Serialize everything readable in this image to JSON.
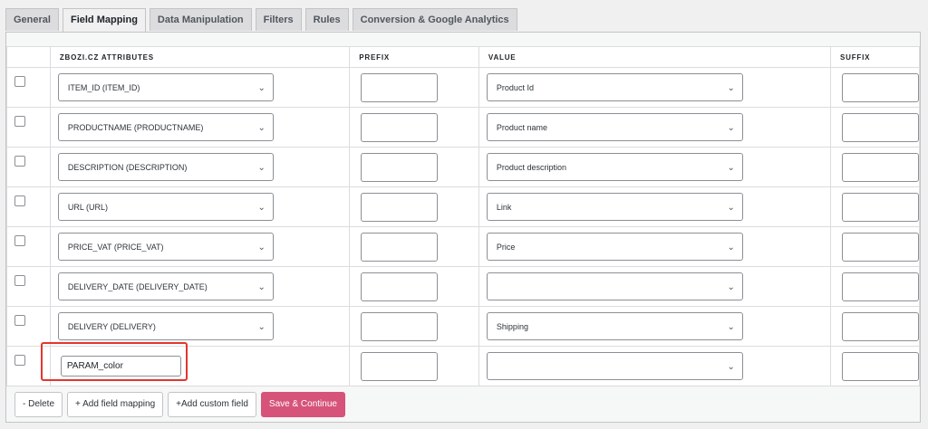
{
  "tabs": [
    {
      "label": "General"
    },
    {
      "label": "Field Mapping",
      "active": true
    },
    {
      "label": "Data Manipulation"
    },
    {
      "label": "Filters"
    },
    {
      "label": "Rules"
    },
    {
      "label": "Conversion & Google Analytics"
    }
  ],
  "table": {
    "headers": [
      "ZBOZI.CZ ATTRIBUTES",
      "PREFIX",
      "VALUE",
      "SUFFIX"
    ],
    "rows": [
      {
        "attribute": "ITEM_ID (ITEM_ID)",
        "value": "Product Id"
      },
      {
        "attribute": "PRODUCTNAME (PRODUCTNAME)",
        "value": "Product name"
      },
      {
        "attribute": "DESCRIPTION (DESCRIPTION)",
        "value": "Product description"
      },
      {
        "attribute": "URL (URL)",
        "value": "Link"
      },
      {
        "attribute": "PRICE_VAT (PRICE_VAT)",
        "value": "Price"
      },
      {
        "attribute": "DELIVERY_DATE (DELIVERY_DATE)",
        "value": ""
      },
      {
        "attribute": "DELIVERY (DELIVERY)",
        "value": "Shipping"
      }
    ],
    "custom_row": {
      "attribute_input": "PARAM_color",
      "value": ""
    }
  },
  "buttons": {
    "delete": "- Delete",
    "add_field": "+ Add field mapping",
    "add_custom": "+Add custom field",
    "save": "Save & Continue"
  },
  "icons": {
    "chevron": "chevron-down-icon"
  },
  "colors": {
    "primary": "#d6537a",
    "highlight": "#e2362f"
  }
}
